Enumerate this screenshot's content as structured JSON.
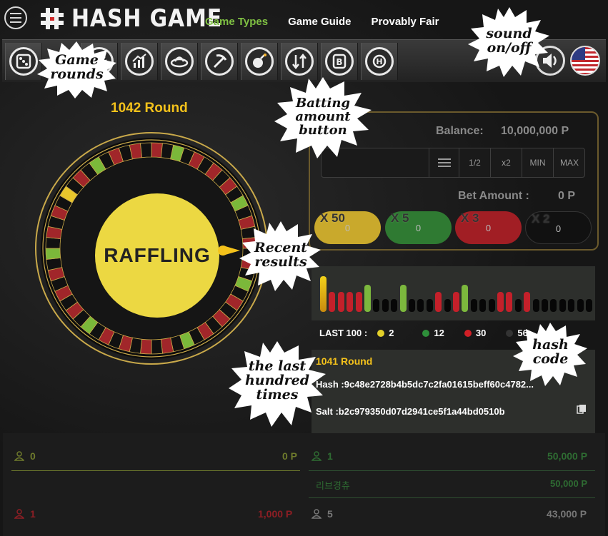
{
  "header": {
    "logo_text": "HASH GAME",
    "nav": [
      {
        "label": "Game Types",
        "active": true
      },
      {
        "label": "Game Guide",
        "active": false
      },
      {
        "label": "Provably Fair",
        "active": false
      }
    ]
  },
  "iconbar": {
    "icons": [
      "dice-icon",
      "roulette-icon",
      "chart-icon",
      "ufo-icon",
      "pickaxe-icon",
      "bomb-icon",
      "up-down-icon",
      "baccarat-icon",
      "hilo-icon"
    ],
    "sound_icon": "speaker-icon",
    "flag_icon": "us-flag-icon"
  },
  "round": {
    "title": "1042 Round",
    "status": "RAFFLING"
  },
  "roulette": {
    "pocket_colors": [
      "red",
      "black",
      "green",
      "black",
      "red",
      "black",
      "red",
      "black",
      "red",
      "black",
      "green",
      "black",
      "red",
      "black",
      "red",
      "black",
      "red",
      "black",
      "green",
      "black",
      "red",
      "black",
      "red",
      "black",
      "red",
      "black",
      "green",
      "black",
      "red",
      "black",
      "red",
      "black",
      "red",
      "black",
      "red",
      "black",
      "green",
      "black",
      "red",
      "black",
      "red",
      "black",
      "red",
      "black",
      "green",
      "black",
      "red",
      "black",
      "red",
      "black",
      "yellow",
      "black",
      "red",
      "black",
      "green",
      "black",
      "red",
      "black",
      "red",
      "black"
    ],
    "colors": {
      "red": "#a1262a",
      "black": "#111111",
      "green": "#7bb83a",
      "yellow": "#e8c62c"
    }
  },
  "betting": {
    "balance_label": "Balance:",
    "balance_value": "10,000,000 P",
    "input_value": "",
    "buttons": [
      "1/2",
      "x2",
      "MIN",
      "MAX"
    ],
    "bet_amount_label": "Bet Amount :",
    "bet_amount_value": "0 P",
    "multipliers": [
      {
        "label": "X 50",
        "value": "0",
        "color": "#c9a92c"
      },
      {
        "label": "X 5",
        "value": "0",
        "color": "#2f7a32"
      },
      {
        "label": "X 3",
        "value": "0",
        "color": "#a11e24"
      },
      {
        "label": "X 2",
        "value": "0",
        "color": "#111111"
      }
    ]
  },
  "recent_results": {
    "bars": [
      {
        "c": "yellow",
        "h": 1.0
      },
      {
        "c": "red",
        "h": 0.55
      },
      {
        "c": "red",
        "h": 0.55
      },
      {
        "c": "red",
        "h": 0.55
      },
      {
        "c": "red",
        "h": 0.55
      },
      {
        "c": "green",
        "h": 0.75
      },
      {
        "c": "black",
        "h": 0.35
      },
      {
        "c": "black",
        "h": 0.35
      },
      {
        "c": "black",
        "h": 0.35
      },
      {
        "c": "green",
        "h": 0.75
      },
      {
        "c": "black",
        "h": 0.35
      },
      {
        "c": "black",
        "h": 0.35
      },
      {
        "c": "black",
        "h": 0.35
      },
      {
        "c": "red",
        "h": 0.55
      },
      {
        "c": "black",
        "h": 0.35
      },
      {
        "c": "red",
        "h": 0.55
      },
      {
        "c": "green",
        "h": 0.75
      },
      {
        "c": "black",
        "h": 0.35
      },
      {
        "c": "black",
        "h": 0.35
      },
      {
        "c": "black",
        "h": 0.35
      },
      {
        "c": "red",
        "h": 0.55
      },
      {
        "c": "red",
        "h": 0.55
      },
      {
        "c": "black",
        "h": 0.35
      },
      {
        "c": "red",
        "h": 0.55
      },
      {
        "c": "black",
        "h": 0.35
      },
      {
        "c": "black",
        "h": 0.35
      },
      {
        "c": "black",
        "h": 0.35
      },
      {
        "c": "black",
        "h": 0.35
      },
      {
        "c": "black",
        "h": 0.35
      },
      {
        "c": "black",
        "h": 0.35
      },
      {
        "c": "black",
        "h": 0.35
      }
    ],
    "bar_colors": {
      "yellow": "#e2b417",
      "red": "#c4202a",
      "green": "#7cb83d",
      "black": "#070707"
    },
    "last100_label": "LAST 100 :",
    "stats": [
      {
        "color": "#e3d02a",
        "value": "2"
      },
      {
        "color": "#2e8f3a",
        "value": "12"
      },
      {
        "color": "#d11f26",
        "value": "30"
      },
      {
        "color": "#333333",
        "value": "56"
      }
    ]
  },
  "hash": {
    "round": "1041 Round",
    "hash_text": "Hash :9c48e2728b4b5dc7c2fa01615beff60c4782...",
    "salt_text": "Salt :b2c979350d07d2941ce5f1a44bd0510b"
  },
  "bettors": {
    "left": [
      {
        "count": "0",
        "amount": "0 P",
        "color": "#6e7a2c"
      },
      {
        "count": "1",
        "amount": "1,000 P",
        "color": "#8e1e24"
      }
    ],
    "right": [
      {
        "count": "1",
        "amount": "50,000 P",
        "color": "#2e6b32"
      },
      {
        "name": "리브경츄",
        "amount": "50,000 P",
        "color": "#2e6b32"
      },
      {
        "count": "5",
        "amount": "43,000 P",
        "color": "#777777"
      }
    ]
  },
  "annotations": {
    "game_rounds": "Game rounds",
    "sound": "sound on/off",
    "batting": "Batting amount button",
    "recent": "Recent results",
    "hash_code": "hash code",
    "last_hundred": "the last hundred times"
  }
}
